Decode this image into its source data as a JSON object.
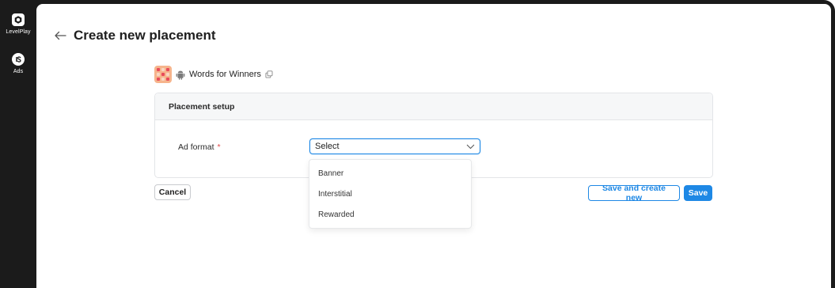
{
  "sidebar": {
    "items": [
      {
        "label": "LevelPlay",
        "icon": "levelplay-logo-icon"
      },
      {
        "label": "Ads",
        "icon": "ironsource-logo-icon"
      }
    ]
  },
  "header": {
    "back_icon": "arrow-left-icon",
    "title": "Create new placement"
  },
  "app": {
    "name": "Words for Winners",
    "platform_icon": "android-icon",
    "copy_icon": "copy-icon"
  },
  "card": {
    "title": "Placement setup",
    "field_label": "Ad format",
    "required_marker": "*",
    "select_value": "Select"
  },
  "dropdown": {
    "options": [
      "Banner",
      "Interstitial",
      "Rewarded"
    ]
  },
  "actions": {
    "cancel_label": "Cancel",
    "save_create_label": "Save and create new",
    "save_label": "Save"
  },
  "colors": {
    "accent": "#1e88e5",
    "required": "#e04848",
    "sidebar": "#1b1b1b"
  }
}
